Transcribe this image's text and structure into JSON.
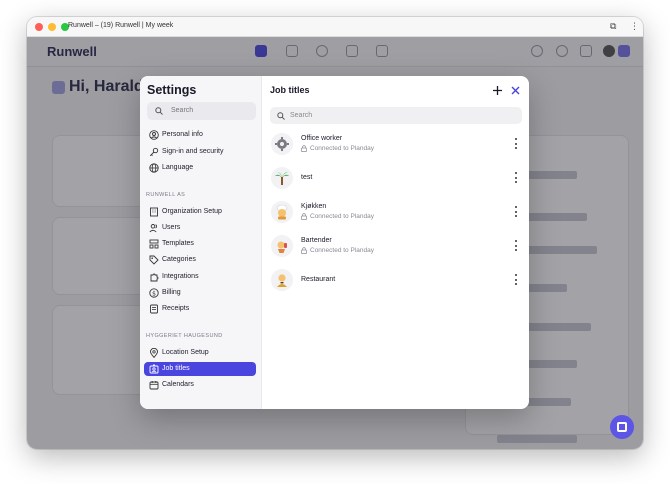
{
  "window": {
    "title": "Runwell – (19) Runwell | My week"
  },
  "app": {
    "logo": "Runwell",
    "greeting": "Hi, Harald!"
  },
  "settings": {
    "title": "Settings",
    "search_placeholder": "Search",
    "personal": [
      {
        "label": "Personal info",
        "icon": "user-circle-icon"
      },
      {
        "label": "Sign-in and security",
        "icon": "key-icon"
      },
      {
        "label": "Language",
        "icon": "globe-icon"
      }
    ],
    "org_section": "RUNWELL AS",
    "org": [
      {
        "label": "Organization Setup",
        "icon": "building-icon"
      },
      {
        "label": "Users",
        "icon": "users-icon"
      },
      {
        "label": "Templates",
        "icon": "templates-icon"
      },
      {
        "label": "Categories",
        "icon": "tag-icon"
      },
      {
        "label": "Integrations",
        "icon": "puzzle-icon"
      },
      {
        "label": "Billing",
        "icon": "dollar-icon"
      },
      {
        "label": "Receipts",
        "icon": "receipt-icon"
      }
    ],
    "location_section": "HYGGERIET HAUGESUND",
    "location": [
      {
        "label": "Location Setup",
        "icon": "map-pin-icon"
      },
      {
        "label": "Job titles",
        "icon": "badge-icon",
        "active": true
      },
      {
        "label": "Calendars",
        "icon": "calendar-icon"
      }
    ]
  },
  "job_titles": {
    "title": "Job titles",
    "search_placeholder": "Search",
    "items": [
      {
        "name": "Office worker",
        "status": "Connected to Planday",
        "icon": "gear-avatar-icon"
      },
      {
        "name": "test",
        "status": "",
        "icon": "palm-tree-icon"
      },
      {
        "name": "Kjøkken",
        "status": "Connected to Planday",
        "icon": "chef-icon"
      },
      {
        "name": "Bartender",
        "status": "Connected to Planday",
        "icon": "cocktail-icon"
      },
      {
        "name": "Restaurant",
        "status": "",
        "icon": "waiter-icon"
      }
    ]
  },
  "colors": {
    "accent": "#4b45e0",
    "overlay": "#23232d"
  }
}
